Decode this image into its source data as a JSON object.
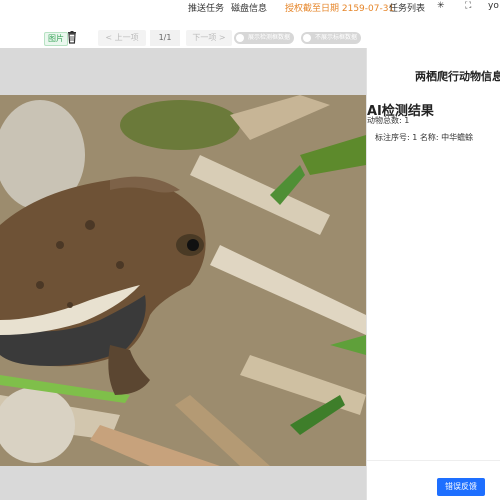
{
  "topnav": {
    "push_tasks": "推送任务",
    "disk_info": "磁盘信息",
    "expire_label": "授权截至日期 2159-07-31",
    "task_list": "任务列表",
    "gear_icon": "✳",
    "fullscreen_icon": "⛶",
    "user": "yo"
  },
  "toolbar": {
    "pic_tag": "图片",
    "prev": "< 上一项",
    "pager": "1/1",
    "next": "下一项 >",
    "toggle_detect": "展示检测框数据",
    "toggle_label": "不展示标框数据"
  },
  "panel": {
    "title": "两栖爬行动物信息",
    "ai_title": "AI检测结果",
    "count_text": "动物总数: 1",
    "label_text": "标注序号: 1 名称: 中华蟾蜍",
    "feedback_button": "错误反馈"
  },
  "colors": {
    "accent": "#1e6fff",
    "expire": "#e6862a",
    "tag": "#3aa55b"
  }
}
